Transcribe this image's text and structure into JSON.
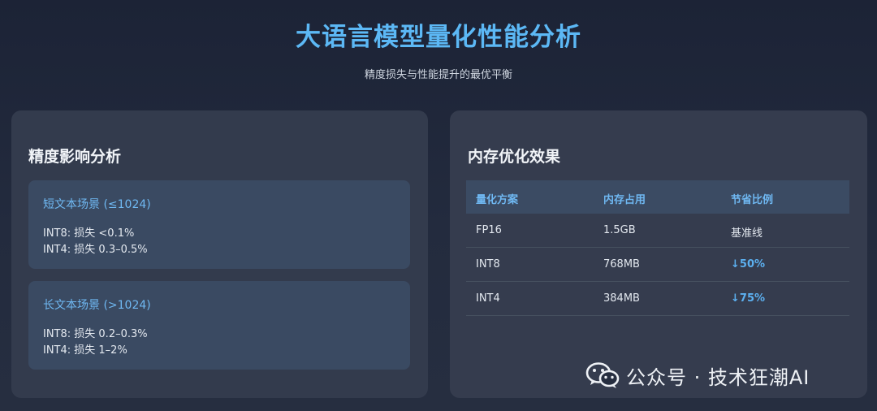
{
  "header": {
    "title": "大语言模型量化性能分析",
    "subtitle": "精度损失与性能提升的最优平衡"
  },
  "accuracy_panel": {
    "title": "精度影响分析",
    "cards": [
      {
        "title": "短文本场景 (≤1024)",
        "lines": [
          "INT8: 损失 <0.1%",
          "INT4: 损失 0.3–0.5%"
        ]
      },
      {
        "title": "长文本场景 (>1024)",
        "lines": [
          "INT8: 损失 0.2–0.3%",
          "INT4: 损失 1–2%"
        ]
      }
    ]
  },
  "memory_panel": {
    "title": "内存优化效果",
    "columns": [
      "量化方案",
      "内存占用",
      "节省比例"
    ],
    "rows": [
      [
        "FP16",
        "1.5GB",
        "基准线"
      ],
      [
        "INT8",
        "768MB",
        "↓50%"
      ],
      [
        "INT4",
        "384MB",
        "↓75%"
      ]
    ]
  },
  "watermark": {
    "text": "公众号 · 技术狂潮AI",
    "icon": "wechat-icon"
  },
  "colors": {
    "accent": "#5cb8f5",
    "background": "#1c2336",
    "panel": "#333b4d",
    "card": "#3a4a62"
  }
}
